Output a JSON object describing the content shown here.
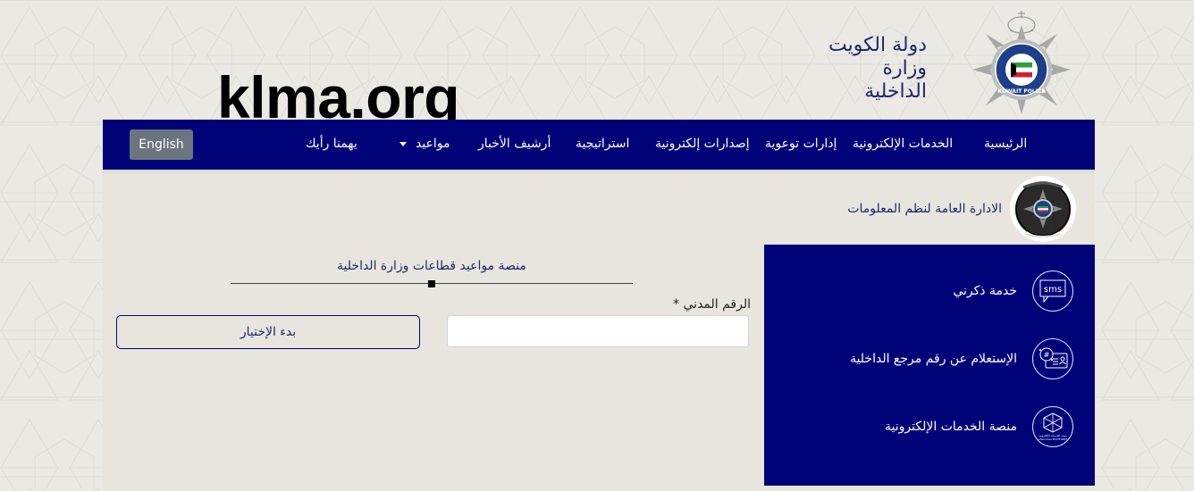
{
  "header": {
    "country_name": "دولة الكويت",
    "ministry_name": "وزارة الداخلية",
    "police_logo_text": "KUWAIT POLICE",
    "watermark": "klma.org"
  },
  "nav": {
    "items": [
      {
        "label": "الرئيسية"
      },
      {
        "label": "الخدمات الإلكترونية"
      },
      {
        "label": "إدارات توعوية"
      },
      {
        "label": "إصدارات إلكترونية"
      },
      {
        "label": "استراتيجية"
      },
      {
        "label": "أرشيف الأخبار"
      },
      {
        "label": "مواعيد",
        "has_dropdown": true
      },
      {
        "label": "يهمنا رأيك"
      }
    ],
    "language_button": "English"
  },
  "department": {
    "title": "الادارة العامة لنظم المعلومات"
  },
  "form": {
    "title": "منصة مواعيد قطاعات وزارة الداخلية",
    "civil_id_label": "الرقم المدني *",
    "civil_id_value": "",
    "civil_id_placeholder": "",
    "start_button": "بدء الإختيار"
  },
  "services": [
    {
      "label": "خدمة ذكرني",
      "icon": "sms-icon",
      "icon_text": "sms"
    },
    {
      "label": "الإستعلام عن رقم مرجع الداخلية",
      "icon": "reference-id-card-icon",
      "icon_text": "#"
    },
    {
      "label": "منصة الخدمات الإلكترونية",
      "icon": "eservices-platform-icon",
      "icon_text": "eServices PLATFORM"
    }
  ],
  "colors": {
    "nav_bg": "#000377",
    "page_bg": "#ebe9e4",
    "panel_bg": "#e8e5de",
    "text_navy": "#1b2a6b",
    "language_button_bg": "#6c757d"
  }
}
